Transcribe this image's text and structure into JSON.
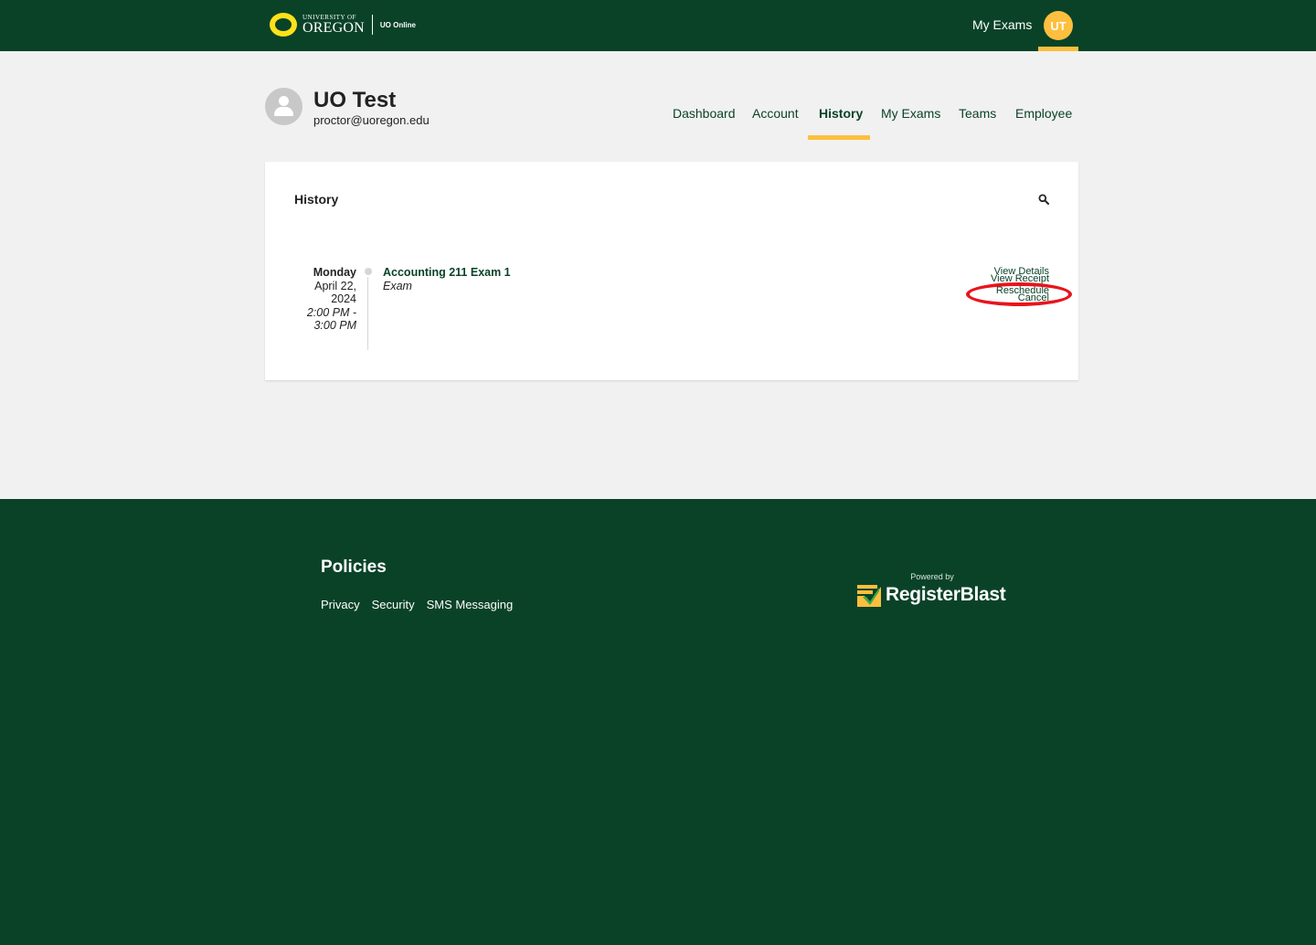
{
  "header": {
    "logo_small": "UNIVERSITY OF",
    "logo_main": "OREGON",
    "logo_sub": "UO Online",
    "my_exams": "My Exams",
    "user_initials": "UT"
  },
  "profile": {
    "name": "UO Test",
    "email": "proctor@uoregon.edu"
  },
  "nav": {
    "items": [
      {
        "label": "Dashboard"
      },
      {
        "label": "Account"
      },
      {
        "label": "History",
        "active": true
      },
      {
        "label": "My Exams"
      },
      {
        "label": "Teams"
      },
      {
        "label": "Employee"
      }
    ]
  },
  "history": {
    "title": "History",
    "entries": [
      {
        "day": "Monday",
        "date_line1": "April 22,",
        "date_line2": "2024",
        "time_line1": "2:00 PM -",
        "time_line2": "3:00 PM",
        "title": "Accounting 211 Exam 1",
        "type": "Exam",
        "actions": [
          "View Details",
          "View Receipt",
          "Reschedule",
          "Cancel"
        ]
      }
    ]
  },
  "footer": {
    "heading": "Policies",
    "links": [
      "Privacy",
      "Security",
      "SMS Messaging"
    ],
    "powered_by": "Powered by",
    "brand": "RegisterBlast"
  },
  "colors": {
    "uo_green": "#0a4228",
    "uo_yellow": "#fee11a",
    "accent_gold": "#fdbf3d",
    "highlight_red": "#e8141c"
  }
}
